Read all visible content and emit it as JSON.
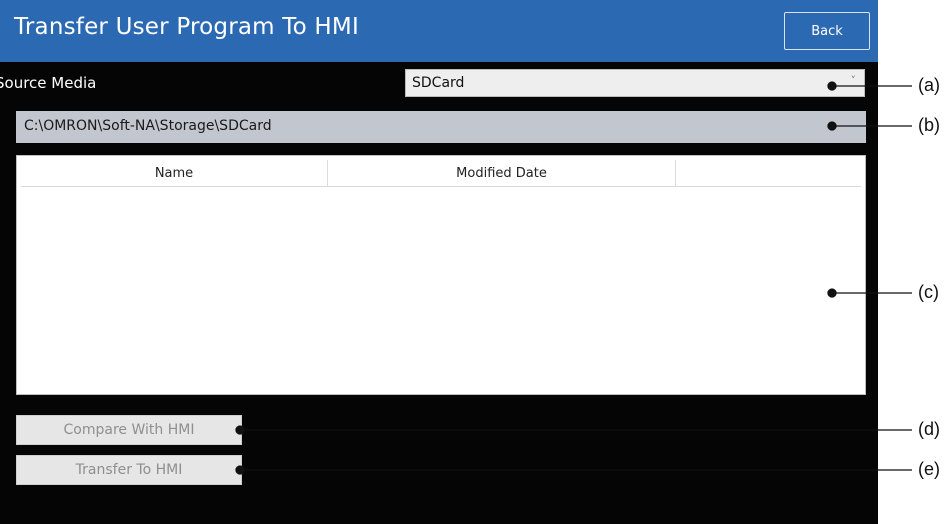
{
  "window": {
    "title": "Transfer User Program To HMI",
    "back_label": "Back"
  },
  "source": {
    "label": "Source Media",
    "selected": "SDCard",
    "caret": "˅"
  },
  "path": "C:\\OMRON\\Soft-NA\\Storage\\SDCard",
  "file_list": {
    "columns": [
      "Name",
      "Modified Date",
      ""
    ],
    "rows": []
  },
  "buttons": {
    "compare_label": "Compare With HMI",
    "transfer_label": "Transfer To HMI"
  },
  "callouts": [
    "(a)",
    "(b)",
    "(c)",
    "(d)",
    "(e)"
  ],
  "colors": {
    "titlebar": "#2b6ab3",
    "background": "#050505",
    "pathbar": "#c2c6cf"
  }
}
